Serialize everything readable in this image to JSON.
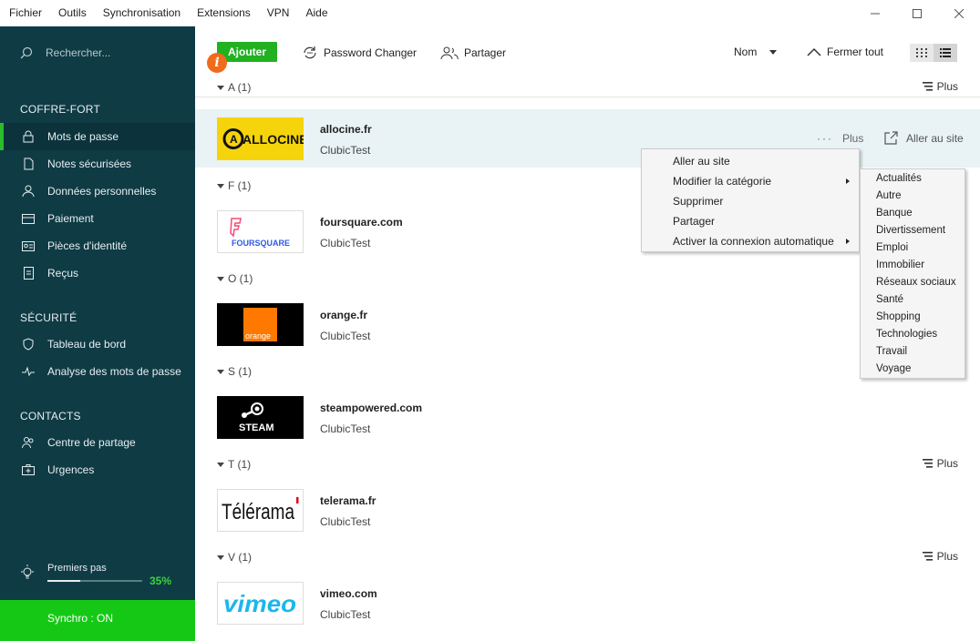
{
  "menubar": [
    "Fichier",
    "Outils",
    "Synchronisation",
    "Extensions",
    "VPN",
    "Aide"
  ],
  "sidebar": {
    "search_placeholder": "Rechercher...",
    "sections": {
      "vault": "COFFRE-FORT",
      "security": "SÉCURITÉ",
      "contacts": "CONTACTS"
    },
    "items": [
      {
        "label": "Mots de passe",
        "icon": "lock-icon"
      },
      {
        "label": "Notes sécurisées",
        "icon": "note-icon"
      },
      {
        "label": "Données personnelles",
        "icon": "person-icon"
      },
      {
        "label": "Paiement",
        "icon": "card-icon"
      },
      {
        "label": "Pièces d'identité",
        "icon": "id-icon"
      },
      {
        "label": "Reçus",
        "icon": "receipt-icon"
      },
      {
        "label": "Tableau de bord",
        "icon": "shield-icon"
      },
      {
        "label": "Analyse des mots de passe",
        "icon": "pulse-icon"
      },
      {
        "label": "Centre de partage",
        "icon": "share-people-icon"
      },
      {
        "label": "Urgences",
        "icon": "emergency-icon"
      }
    ],
    "first_steps": {
      "label": "Premiers pas",
      "percent": "35%",
      "progress": 0.35
    },
    "sync": "Synchro : ON",
    "accent": "#2bbd2b"
  },
  "toolbar": {
    "add": "Ajouter",
    "password_changer": "Password Changer",
    "share": "Partager",
    "sort": "Nom",
    "close_all": "Fermer tout"
  },
  "groups": [
    {
      "letter": "A (1)",
      "plus": "Plus"
    },
    {
      "letter": "F (1)"
    },
    {
      "letter": "O (1)"
    },
    {
      "letter": "S (1)"
    },
    {
      "letter": "T (1)",
      "plus": "Plus"
    },
    {
      "letter": "V (1)",
      "plus": "Plus"
    }
  ],
  "entries": [
    {
      "title": "allocine.fr",
      "user": "ClubicTest",
      "logo_text": "ALLOCINE",
      "more": "Plus",
      "go": "Aller au site"
    },
    {
      "title": "foursquare.com",
      "user": "ClubicTest",
      "logo_text": "FOURSQUARE"
    },
    {
      "title": "orange.fr",
      "user": "ClubicTest",
      "logo_text": "orange"
    },
    {
      "title": "steampowered.com",
      "user": "ClubicTest",
      "logo_text": "STEAM"
    },
    {
      "title": "telerama.fr",
      "user": "ClubicTest",
      "logo_text": "Télérama"
    },
    {
      "title": "vimeo.com",
      "user": "ClubicTest",
      "logo_text": "vimeo"
    }
  ],
  "context_menu": [
    "Aller au site",
    "Modifier la catégorie",
    "Supprimer",
    "Partager",
    "Activer la connexion automatique"
  ],
  "categories": [
    "Actualités",
    "Autre",
    "Banque",
    "Divertissement",
    "Emploi",
    "Immobilier",
    "Réseaux sociaux",
    "Santé",
    "Shopping",
    "Technologies",
    "Travail",
    "Voyage"
  ]
}
